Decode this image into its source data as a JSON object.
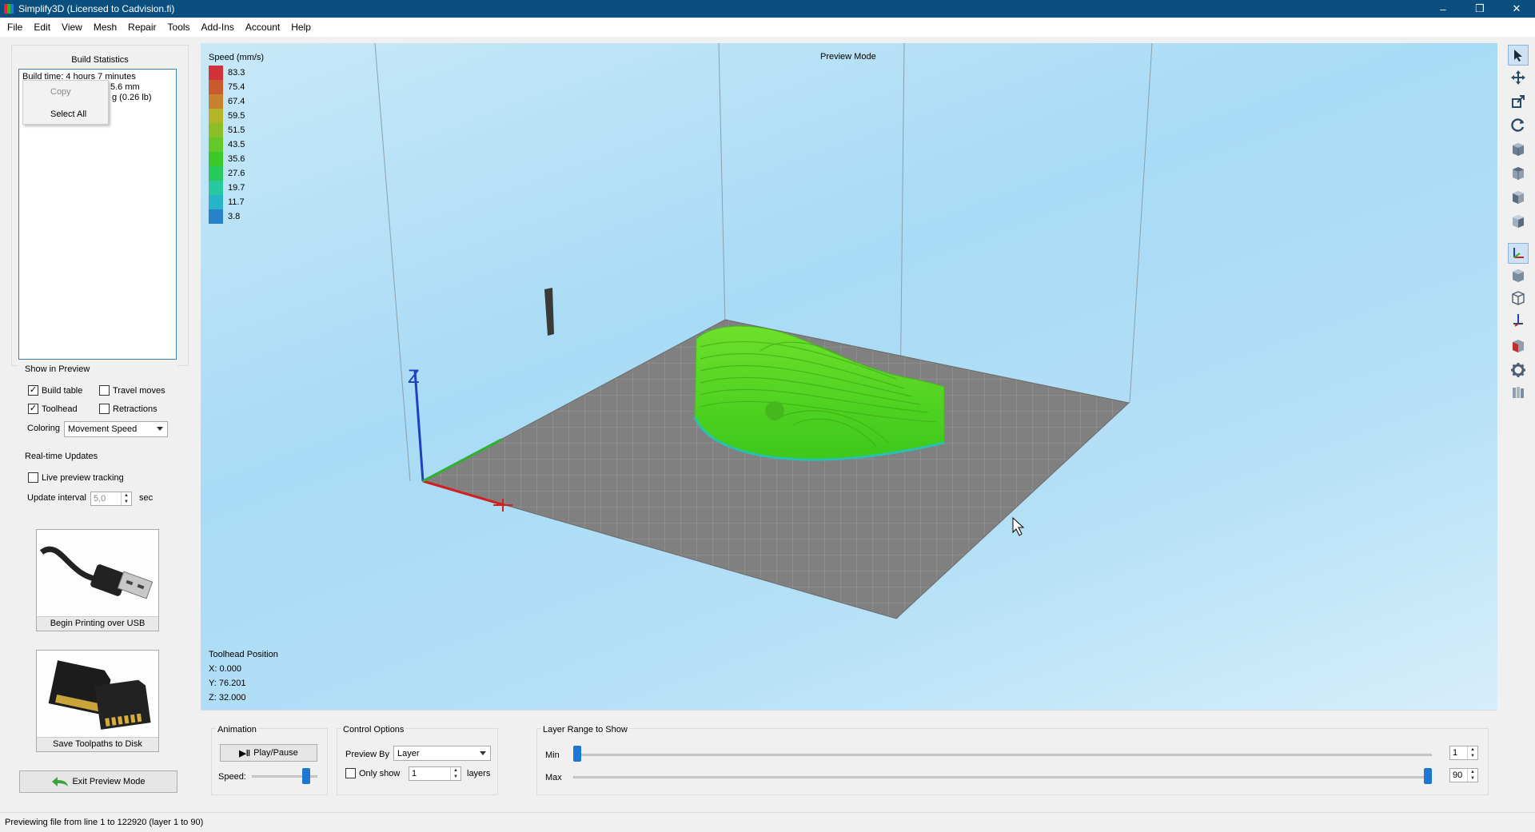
{
  "window": {
    "title": "Simplify3D (Licensed to Cadvision.fi)",
    "minimize": "–",
    "restore": "❐",
    "close": "✕"
  },
  "menu": [
    "File",
    "Edit",
    "View",
    "Mesh",
    "Repair",
    "Tools",
    "Add-Ins",
    "Account",
    "Help"
  ],
  "build_stats": {
    "title": "Build Statistics",
    "line1": "Build time: 4 hours 7 minutes",
    "line2": "Filament length: 31.6 mm",
    "line3": "Plastic weight: g (0.26 lb)",
    "line2_visible": "5.6 mm",
    "line3_visible": "g (0.26 lb)",
    "line1_visible": "Build time: 4 hours 7 minutes"
  },
  "context_menu": {
    "copy": "Copy",
    "select_all": "Select All"
  },
  "show_in_preview": {
    "title": "Show in Preview",
    "build_table": "Build table",
    "travel_moves": "Travel moves",
    "toolhead": "Toolhead",
    "retractions": "Retractions",
    "coloring_label": "Coloring",
    "coloring_value": "Movement Speed"
  },
  "realtime": {
    "title": "Real-time Updates",
    "live_tracking": "Live preview tracking",
    "interval_label": "Update interval",
    "interval_value": "5,0",
    "interval_unit": "sec"
  },
  "usb_button": "Begin Printing over USB",
  "sd_button": "Save Toolpaths to Disk",
  "exit_button": "Exit Preview Mode",
  "viewport": {
    "legend_title": "Speed (mm/s)",
    "legend": [
      {
        "value": "83.3",
        "color": "#d2323c"
      },
      {
        "value": "75.4",
        "color": "#c85a2d"
      },
      {
        "value": "67.4",
        "color": "#c8822d"
      },
      {
        "value": "59.5",
        "color": "#b4b428"
      },
      {
        "value": "51.5",
        "color": "#8cbe28"
      },
      {
        "value": "43.5",
        "color": "#64c828"
      },
      {
        "value": "35.6",
        "color": "#3cc828"
      },
      {
        "value": "27.6",
        "color": "#28c85a"
      },
      {
        "value": "19.7",
        "color": "#28c8a0"
      },
      {
        "value": "11.7",
        "color": "#28b4c8"
      },
      {
        "value": "3.8",
        "color": "#2882c8"
      }
    ],
    "mode_label": "Preview Mode",
    "axis_z": "Z",
    "toolhead_title": "Toolhead Position",
    "toolhead_x": "X: 0.000",
    "toolhead_y": "Y: 76.201",
    "toolhead_z": "Z: 32.000"
  },
  "animation": {
    "title": "Animation",
    "play_pause": "Play/Pause",
    "speed_label": "Speed:"
  },
  "control_options": {
    "title": "Control Options",
    "preview_by_label": "Preview By",
    "preview_by_value": "Layer",
    "only_show": "Only show",
    "only_show_value": "1",
    "layers": "layers"
  },
  "layer_range": {
    "title": "Layer Range to Show",
    "min_label": "Min",
    "max_label": "Max",
    "min_value": "1",
    "max_value": "90",
    "min_fraction": 0.0,
    "max_fraction": 1.0
  },
  "status": "Previewing file from line 1 to 122920 (layer 1 to 90)"
}
